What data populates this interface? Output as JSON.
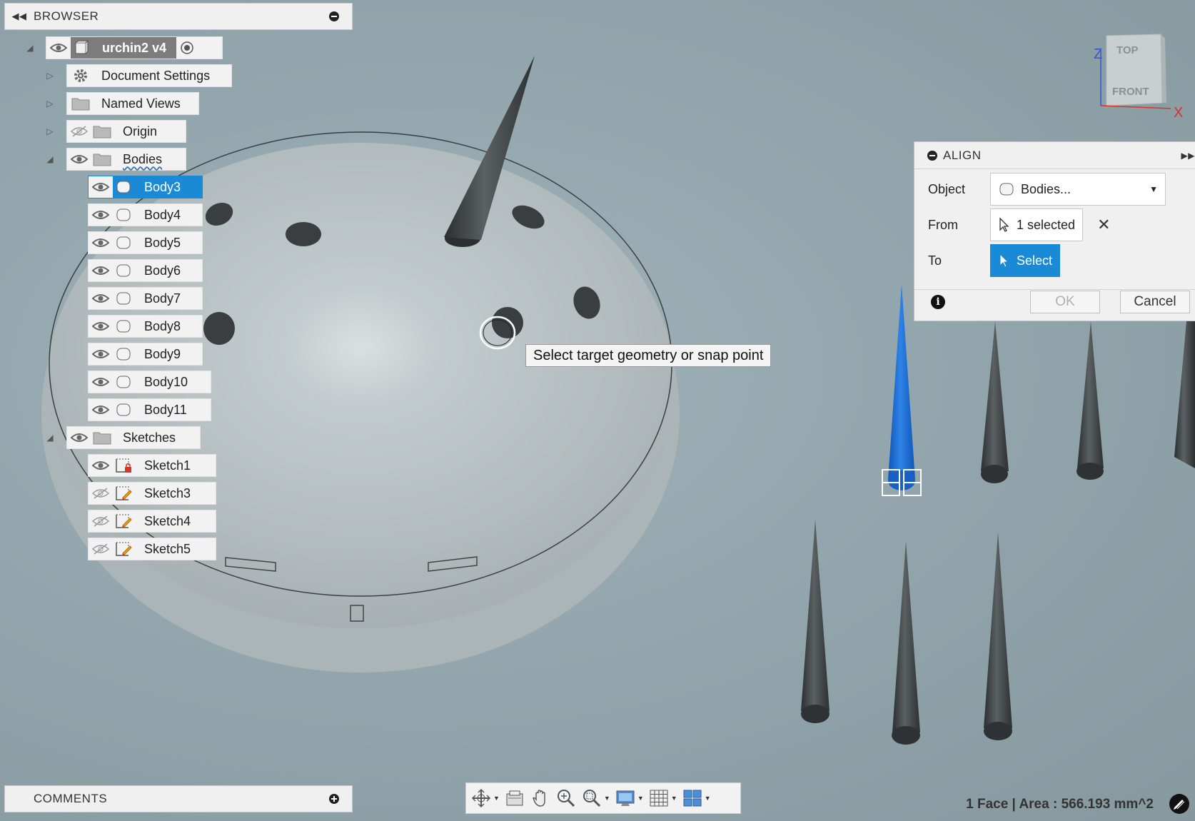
{
  "browser": {
    "title": "BROWSER",
    "root": {
      "label": "urchin2 v4"
    },
    "items": {
      "document_settings": "Document Settings",
      "named_views": "Named Views",
      "origin": "Origin",
      "bodies": "Bodies",
      "sketches": "Sketches"
    },
    "bodies": [
      "Body3",
      "Body4",
      "Body5",
      "Body6",
      "Body7",
      "Body8",
      "Body9",
      "Body10",
      "Body11"
    ],
    "selected_body": "Body3",
    "sketches": [
      "Sketch1",
      "Sketch3",
      "Sketch4",
      "Sketch5"
    ]
  },
  "comments": {
    "title": "COMMENTS"
  },
  "align_dialog": {
    "title": "ALIGN",
    "object_label": "Object",
    "object_value": "Bodies...",
    "from_label": "From",
    "from_value": "1 selected",
    "to_label": "To",
    "to_value": "Select",
    "ok_label": "OK",
    "cancel_label": "Cancel",
    "info_symbol": "i"
  },
  "tooltip": {
    "text": "Select target geometry or snap point"
  },
  "viewcube": {
    "top": "TOP",
    "front": "FRONT",
    "axis_z": "Z",
    "axis_x": "X"
  },
  "status": {
    "text": "1 Face | Area : 566.193 mm^2"
  },
  "colors": {
    "accent": "#1a8ad6",
    "viewport": "#8ea2aa",
    "selected_body": "#1d6fd1"
  },
  "icons": [
    "eye-icon",
    "eye-hidden-icon",
    "gear-icon",
    "folder-icon",
    "body-icon",
    "sketch-icon",
    "component-icon",
    "radio-icon",
    "cursor-icon",
    "orbit-icon",
    "look-at-icon",
    "pan-icon",
    "zoom-icon",
    "fit-icon",
    "display-icon",
    "grid-icon",
    "viewports-icon"
  ]
}
